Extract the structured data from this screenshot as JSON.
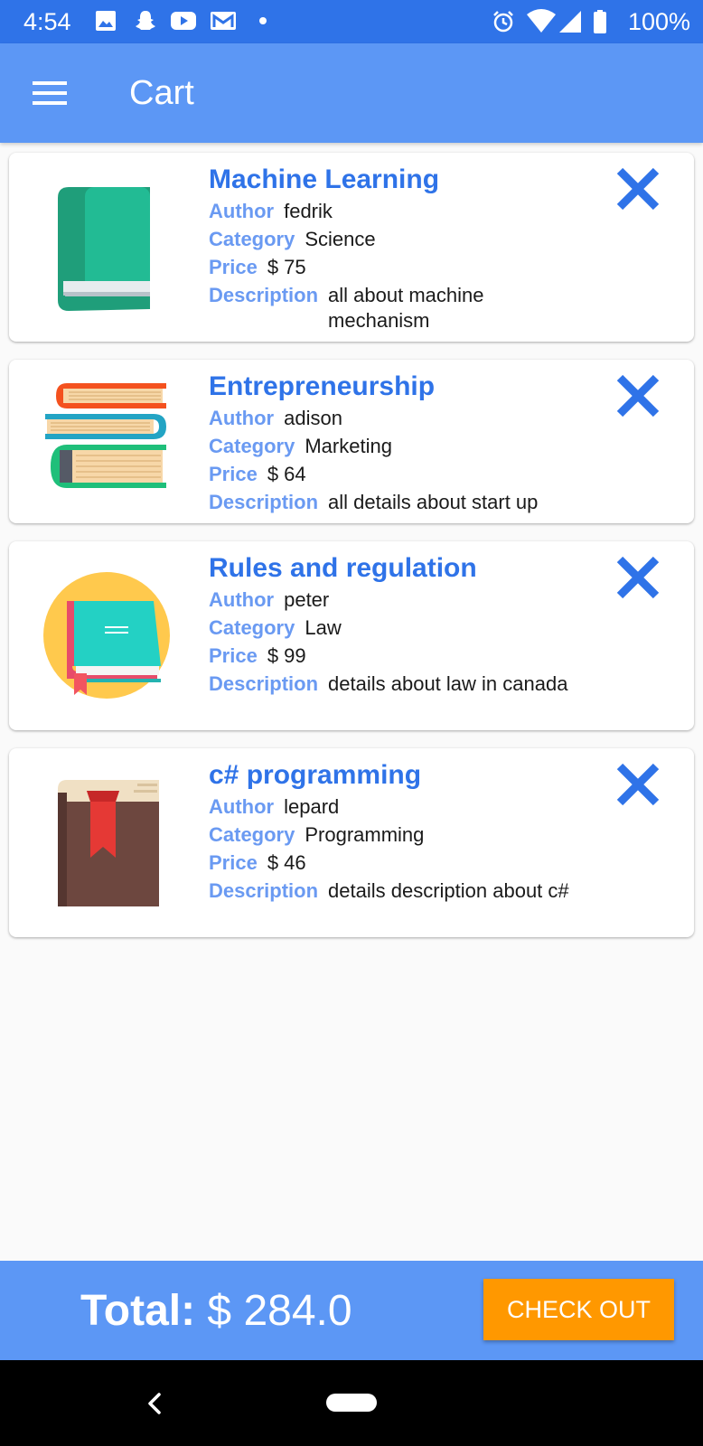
{
  "status_bar": {
    "time": "4:54",
    "battery": "100%",
    "icons": [
      "image-icon",
      "snapchat-icon",
      "youtube-icon",
      "gmail-icon",
      "dot-icon",
      "alarm-icon",
      "wifi-icon",
      "signal-icon",
      "battery-icon"
    ]
  },
  "app_bar": {
    "title": "Cart",
    "menu_icon": "hamburger-menu-icon"
  },
  "labels": {
    "author": "Author",
    "category": "Category",
    "price": "Price",
    "description": "Description"
  },
  "colors": {
    "primary": "#5c97f5",
    "status": "#2f73e8",
    "title": "#2f73e8",
    "label": "#6a9af2",
    "checkout": "#ff9800"
  },
  "cart_items": [
    {
      "title": "Machine Learning",
      "author": "fedrik",
      "category": "Science",
      "price": "$ 75",
      "description": "all about machine mechanism",
      "icon": "green-book-icon"
    },
    {
      "title": "Entrepreneurship",
      "author": "adison",
      "category": "Marketing",
      "price": "$ 64",
      "description": "all details about start up",
      "icon": "stacked-books-icon"
    },
    {
      "title": "Rules and regulation",
      "author": "peter",
      "category": "Law",
      "price": "$ 99",
      "description": "details about law in canada",
      "icon": "teal-book-icon"
    },
    {
      "title": "c# programming",
      "author": "lepard",
      "category": "Programming",
      "price": "$ 46",
      "description": "details description about c#",
      "icon": "brown-book-icon"
    }
  ],
  "footer": {
    "total_label": "Total:",
    "total_value": "$ 284.0",
    "checkout_label": "CHECK OUT"
  }
}
